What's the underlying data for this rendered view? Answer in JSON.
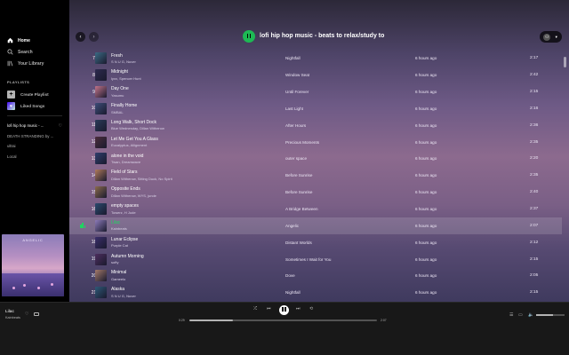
{
  "sidebar": {
    "nav": [
      {
        "label": "Home",
        "icon": "home-icon"
      },
      {
        "label": "Search",
        "icon": "search-icon"
      },
      {
        "label": "Your Library",
        "icon": "library-icon"
      }
    ],
    "section_title": "PLAYLISTS",
    "create_label": "Create Playlist",
    "liked_label": "Liked Songs",
    "playlists": [
      "lofi hip hop music - ...",
      "DEATH STRANDING by ...",
      "ultrai",
      "Local"
    ],
    "cover_title": "ANGELIC"
  },
  "header": {
    "title": "lofi hip hop music - beats to relax/study to"
  },
  "tracks": [
    {
      "num": "7",
      "title": "Fresh",
      "artist": "S N U G, Nuver",
      "album": "Nightfall",
      "added": "6 hours ago",
      "duration": "2:17",
      "color": "#3b6b84"
    },
    {
      "num": "8",
      "title": "Midnight",
      "artist": "lyxx, Spencer Hunt",
      "album": "Window Seat",
      "added": "6 hours ago",
      "duration": "2:42",
      "color": "#2c2a4e"
    },
    {
      "num": "9",
      "title": "Day One",
      "artist": "Yasumu",
      "album": "Until Forever",
      "added": "6 hours ago",
      "duration": "2:15",
      "color": "#c2748a"
    },
    {
      "num": "10",
      "title": "Finally Home",
      "artist": "SMBAL",
      "album": "Last Light",
      "added": "6 hours ago",
      "duration": "2:16",
      "color": "#3e4d78"
    },
    {
      "num": "11",
      "title": "Long Walk, Short Dock",
      "artist": "Blue Wednesday, Dillan Witherow",
      "album": "After Hours",
      "added": "6 hours ago",
      "duration": "2:36",
      "color": "#2b3b59"
    },
    {
      "num": "12",
      "title": "Let Me Get You A Glass",
      "artist": "Eucalyptus, Allignment",
      "album": "Precious Moments",
      "added": "6 hours ago",
      "duration": "2:35",
      "color": "#4b2d3c"
    },
    {
      "num": "13",
      "title": "alone in the void",
      "artist": "Twan, Dreamwave",
      "album": "outer space",
      "added": "6 hours ago",
      "duration": "2:20",
      "color": "#2f3e6c"
    },
    {
      "num": "14",
      "title": "Field of Stars",
      "artist": "Dillan Witherow, Sitting Duck, No Spirit",
      "album": "Before Sunrise",
      "added": "6 hours ago",
      "duration": "2:35",
      "color": "#b07a5b"
    },
    {
      "num": "15",
      "title": "Opposite Ends",
      "artist": "Dillan Witherow, WYS, junde",
      "album": "Before Sunrise",
      "added": "6 hours ago",
      "duration": "2:40",
      "color": "#8b6a4c"
    },
    {
      "num": "16",
      "title": "empty spaces",
      "artist": "Towerz, H Jude",
      "album": "A Bridge Between",
      "added": "6 hours ago",
      "duration": "2:37",
      "color": "#2b4a6e"
    },
    {
      "num": "17",
      "title": "Lilac",
      "artist": "Kainbeats",
      "album": "Angelic",
      "added": "6 hours ago",
      "duration": "2:07",
      "color": "#8c7ab8",
      "playing": true
    },
    {
      "num": "18",
      "title": "Lunar Eclipse",
      "artist": "Purple Cat",
      "album": "Distant Worlds",
      "added": "6 hours ago",
      "duration": "2:12",
      "color": "#3a2e6b"
    },
    {
      "num": "19",
      "title": "Autumn Morning",
      "artist": "softy",
      "album": "Sometimes I Wait for You",
      "added": "6 hours ago",
      "duration": "2:15",
      "color": "#4d2e5e"
    },
    {
      "num": "20",
      "title": "Minimal",
      "artist": "Gameelo",
      "album": "Dove",
      "added": "6 hours ago",
      "duration": "2:05",
      "color": "#a47a6a"
    },
    {
      "num": "21",
      "title": "Alaska",
      "artist": "S N U G, Nuver",
      "album": "Nightfall",
      "added": "6 hours ago",
      "duration": "2:15",
      "color": "#2e5a78"
    }
  ],
  "player": {
    "title": "Lilac",
    "artist": "Kainbeats",
    "elapsed": "0:29",
    "total": "2:07",
    "progress": 0.23,
    "volume": 0.6
  }
}
